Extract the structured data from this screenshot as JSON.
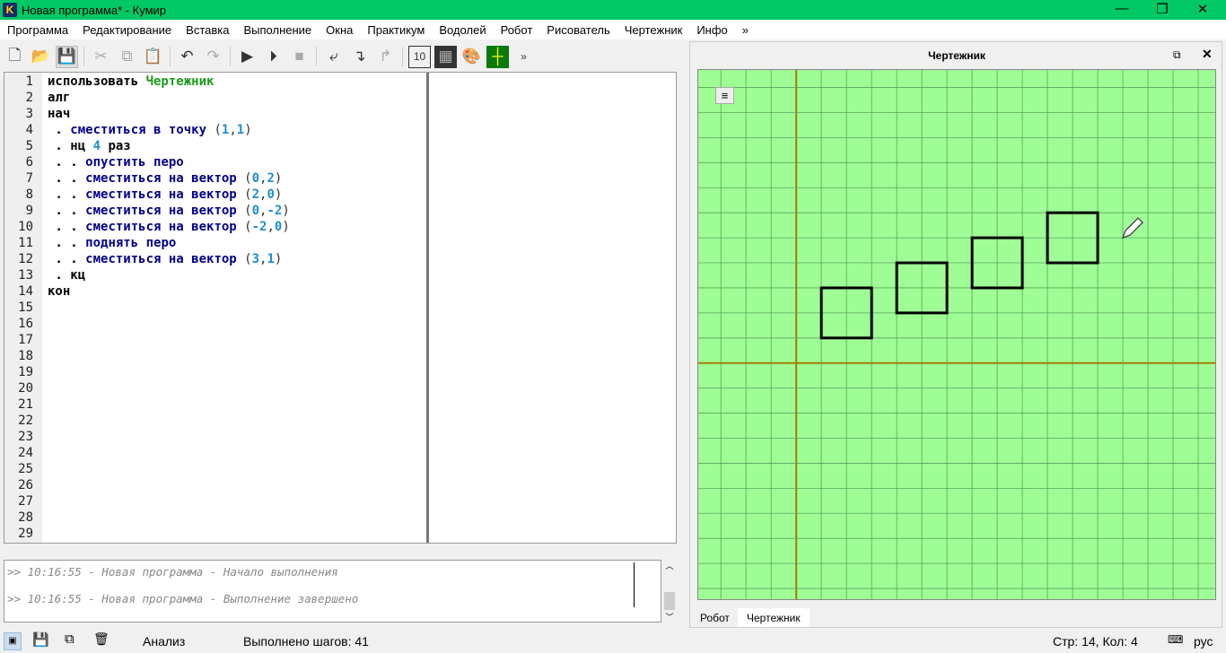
{
  "window": {
    "title": "Новая программа* - Кумир",
    "logo": "K"
  },
  "menu": [
    "Программа",
    "Редактирование",
    "Вставка",
    "Выполнение",
    "Окна",
    "Практикум",
    "Водолей",
    "Робот",
    "Рисователь",
    "Чертежник",
    "Инфо",
    "»"
  ],
  "toolbar": {
    "more": "»"
  },
  "editor": {
    "line_numbers": [
      "1",
      "2",
      "3",
      "4",
      "5",
      "6",
      "7",
      "8",
      "9",
      "10",
      "11",
      "12",
      "13",
      "14",
      "15",
      "16",
      "17",
      "18",
      "19",
      "20",
      "21",
      "22",
      "23",
      "24",
      "25",
      "26",
      "27",
      "28",
      "29"
    ],
    "lines": [
      [
        {
          "t": "использовать ",
          "c": "kw"
        },
        {
          "t": "Чертежник",
          "c": "mod"
        }
      ],
      [
        {
          "t": "алг",
          "c": "kw"
        }
      ],
      [
        {
          "t": "нач",
          "c": "kw"
        }
      ],
      [
        {
          "t": " . ",
          "c": "kw"
        },
        {
          "t": "сместиться в точку ",
          "c": "fn"
        },
        {
          "t": "(",
          "c": "pn"
        },
        {
          "t": "1",
          "c": "num"
        },
        {
          "t": ",",
          "c": "pn"
        },
        {
          "t": "1",
          "c": "num"
        },
        {
          "t": ")",
          "c": "pn"
        }
      ],
      [
        {
          "t": " . нц ",
          "c": "kw"
        },
        {
          "t": "4",
          "c": "num"
        },
        {
          "t": " раз",
          "c": "kw"
        }
      ],
      [
        {
          "t": " . . ",
          "c": "kw"
        },
        {
          "t": "опустить перо",
          "c": "fn"
        }
      ],
      [
        {
          "t": " . . ",
          "c": "kw"
        },
        {
          "t": "сместиться на вектор ",
          "c": "fn"
        },
        {
          "t": "(",
          "c": "pn"
        },
        {
          "t": "0",
          "c": "num"
        },
        {
          "t": ",",
          "c": "pn"
        },
        {
          "t": "2",
          "c": "num"
        },
        {
          "t": ")",
          "c": "pn"
        }
      ],
      [
        {
          "t": " . . ",
          "c": "kw"
        },
        {
          "t": "сместиться на вектор ",
          "c": "fn"
        },
        {
          "t": "(",
          "c": "pn"
        },
        {
          "t": "2",
          "c": "num"
        },
        {
          "t": ",",
          "c": "pn"
        },
        {
          "t": "0",
          "c": "num"
        },
        {
          "t": ")",
          "c": "pn"
        }
      ],
      [
        {
          "t": " . . ",
          "c": "kw"
        },
        {
          "t": "сместиться на вектор ",
          "c": "fn"
        },
        {
          "t": "(",
          "c": "pn"
        },
        {
          "t": "0",
          "c": "num"
        },
        {
          "t": ",",
          "c": "pn"
        },
        {
          "t": "-2",
          "c": "num"
        },
        {
          "t": ")",
          "c": "pn"
        }
      ],
      [
        {
          "t": " . . ",
          "c": "kw"
        },
        {
          "t": "сместиться на вектор ",
          "c": "fn"
        },
        {
          "t": "(",
          "c": "pn"
        },
        {
          "t": "-2",
          "c": "num"
        },
        {
          "t": ",",
          "c": "pn"
        },
        {
          "t": "0",
          "c": "num"
        },
        {
          "t": ")",
          "c": "pn"
        }
      ],
      [
        {
          "t": " . . ",
          "c": "kw"
        },
        {
          "t": "поднять перо",
          "c": "fn"
        }
      ],
      [
        {
          "t": " . . ",
          "c": "kw"
        },
        {
          "t": "сместиться на вектор ",
          "c": "fn"
        },
        {
          "t": "(",
          "c": "pn"
        },
        {
          "t": "3",
          "c": "num"
        },
        {
          "t": ",",
          "c": "pn"
        },
        {
          "t": "1",
          "c": "num"
        },
        {
          "t": ")",
          "c": "pn"
        }
      ],
      [
        {
          "t": " . кц",
          "c": "kw"
        }
      ],
      [
        {
          "t": "кон",
          "c": "kw"
        }
      ]
    ]
  },
  "console": [
    ">> 10:16:55 - Новая программа - Начало выполнения",
    ">> 10:16:55 - Новая программа - Выполнение завершено"
  ],
  "status": {
    "analysis": "Анализ",
    "steps": "Выполнено шагов: 41",
    "position": "Стр: 14, Кол: 4",
    "lang": "рус"
  },
  "drawer": {
    "title": "Чертежник",
    "tabs": [
      "Робот",
      "Чертежник"
    ],
    "active_tab": 1,
    "squares": [
      [
        1,
        1
      ],
      [
        4,
        2
      ],
      [
        7,
        3
      ],
      [
        10,
        4
      ]
    ],
    "square_size": 2,
    "pen": [
      13,
      5
    ],
    "view": {
      "xmin": -3.9,
      "xmax": 16.75,
      "ymin": -9.5,
      "ymax": 11.7
    },
    "colors": {
      "bg": "#9ffd96",
      "grid": "#5aa35a",
      "axis": "#a08000",
      "line": "#000000"
    }
  }
}
